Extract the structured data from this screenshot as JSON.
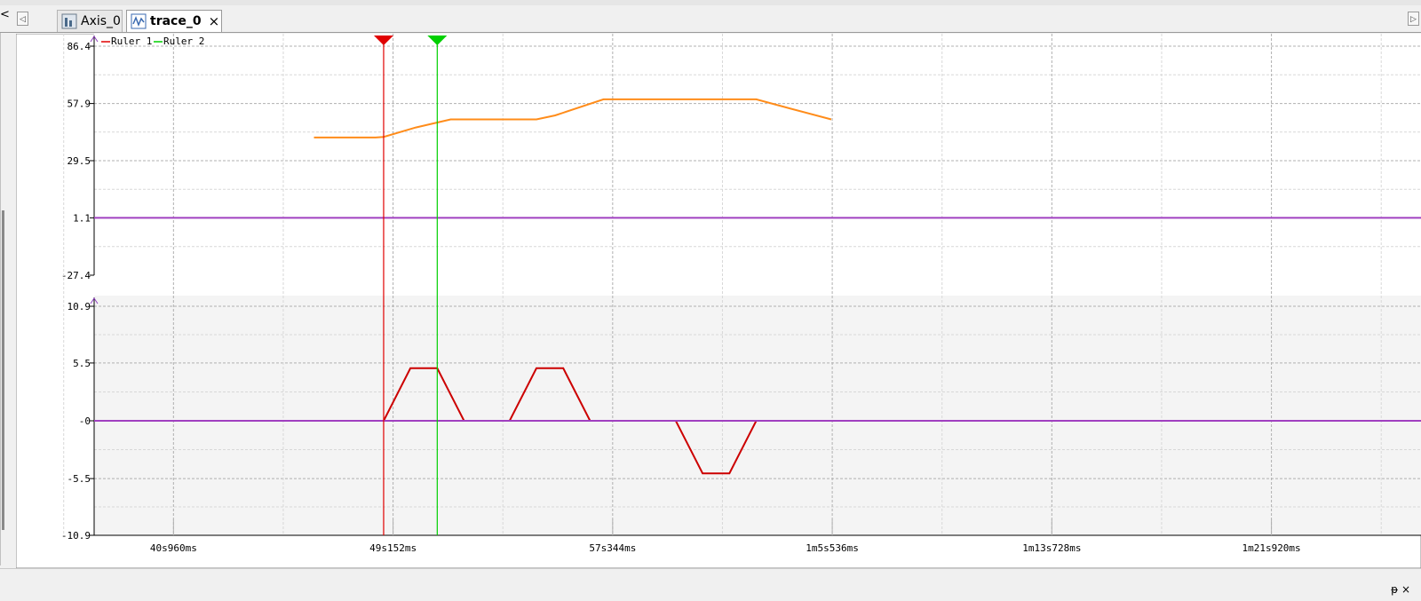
{
  "tabs": [
    {
      "label": "Axis_0",
      "icon": "axis-chart-icon"
    },
    {
      "label": "trace_0",
      "icon": "trace-wave-icon",
      "close": "×"
    }
  ],
  "nav": {
    "left": "◁",
    "right": "▷",
    "collapse": "<"
  },
  "status": {
    "pin": "ᵽ ×"
  },
  "chart_data": {
    "type": "line",
    "legend": [
      {
        "name": "Ruler 1",
        "color": "#e00000"
      },
      {
        "name": "Ruler 2",
        "color": "#00d000"
      }
    ],
    "x_tick_labels": [
      "40s960ms",
      "49s152ms",
      "57s344ms",
      "1m5s536ms",
      "1m13s728ms",
      "1m21s920ms"
    ],
    "x_tick_values_ms": [
      40960,
      49152,
      57344,
      65536,
      73728,
      81920
    ],
    "xlim_ms": [
      38000,
      87500
    ],
    "rulers_ms": [
      {
        "name": "Ruler 1",
        "x": 48800,
        "color": "#e00000"
      },
      {
        "name": "Ruler 2",
        "x": 50800,
        "color": "#00d000"
      }
    ],
    "panels": [
      {
        "ylim": [
          -27.4,
          86.4
        ],
        "ytick_labels": [
          "86.4",
          "57.9",
          "29.5",
          "1.1",
          "-27.4"
        ],
        "ytick_values": [
          86.4,
          57.9,
          29.5,
          1.1,
          -27.4
        ],
        "background": "#ffffff",
        "series": [
          {
            "color": "#ff8c1a",
            "x_ms": [
              46200,
              48500,
              48800,
              50000,
              51300,
              52800,
              54500,
              55200,
              57000,
              59800,
              62700,
              63800,
              65500
            ],
            "y": [
              41,
              41,
              41.3,
              46,
              50,
              50,
              50,
              52,
              60,
              60,
              60,
              56,
              50
            ]
          },
          {
            "color": "#a040c0",
            "x_ms": [
              38000,
              87500
            ],
            "y": [
              1.1,
              1.1
            ]
          }
        ]
      },
      {
        "ylim": [
          -10.9,
          10.9
        ],
        "ytick_labels": [
          "10.9",
          "5.5",
          "-0",
          "-5.5",
          "-10.9"
        ],
        "ytick_values": [
          10.9,
          5.5,
          0,
          -5.5,
          -10.9
        ],
        "background": "#f4f4f4",
        "series": [
          {
            "color": "#cc0000",
            "x_ms": [
              46200,
              48800,
              49800,
              50800,
              51800,
              53500,
              54500,
              55500,
              56500,
              59700,
              60700,
              61700,
              62700,
              63700,
              65500
            ],
            "y": [
              0,
              0,
              5,
              5,
              0,
              0,
              5,
              5,
              0,
              0,
              -5,
              -5,
              0,
              0,
              0
            ]
          },
          {
            "color": "#a040c0",
            "x_ms": [
              38000,
              87500
            ],
            "y": [
              0,
              0
            ]
          }
        ]
      }
    ]
  }
}
